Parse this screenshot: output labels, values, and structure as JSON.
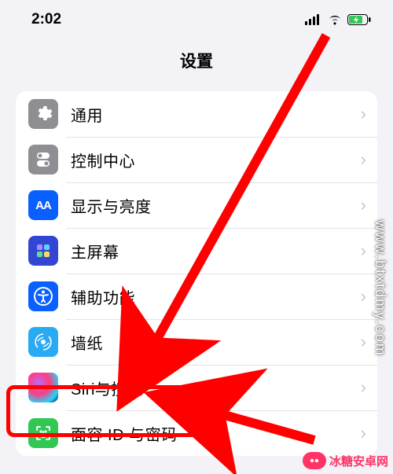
{
  "status": {
    "time": "2:02"
  },
  "header": {
    "title": "设置"
  },
  "rows": [
    {
      "id": "general",
      "label": "通用",
      "icon_bg": "#8e8e93"
    },
    {
      "id": "control-center",
      "label": "控制中心",
      "icon_bg": "#8e8e93"
    },
    {
      "id": "display",
      "label": "显示与亮度",
      "icon_bg": "#0a60ff"
    },
    {
      "id": "home-screen",
      "label": "主屏幕",
      "icon_bg": "#3246d3"
    },
    {
      "id": "accessibility",
      "label": "辅助功能",
      "icon_bg": "#0a60ff"
    },
    {
      "id": "wallpaper",
      "label": "墙纸",
      "icon_bg": "#29aaf2"
    },
    {
      "id": "siri",
      "label": "Siri与搜索",
      "icon_bg": "#111"
    },
    {
      "id": "faceid",
      "label": "面容 ID 与密码",
      "icon_bg": "#30c752"
    }
  ],
  "annotations": {
    "highlight_row": "siri",
    "arrows": [
      "top-to-wallpaper",
      "right-to-siri"
    ]
  },
  "watermark": {
    "vertical": "www.btxtdmy.com",
    "brand": "冰糖安卓网"
  }
}
